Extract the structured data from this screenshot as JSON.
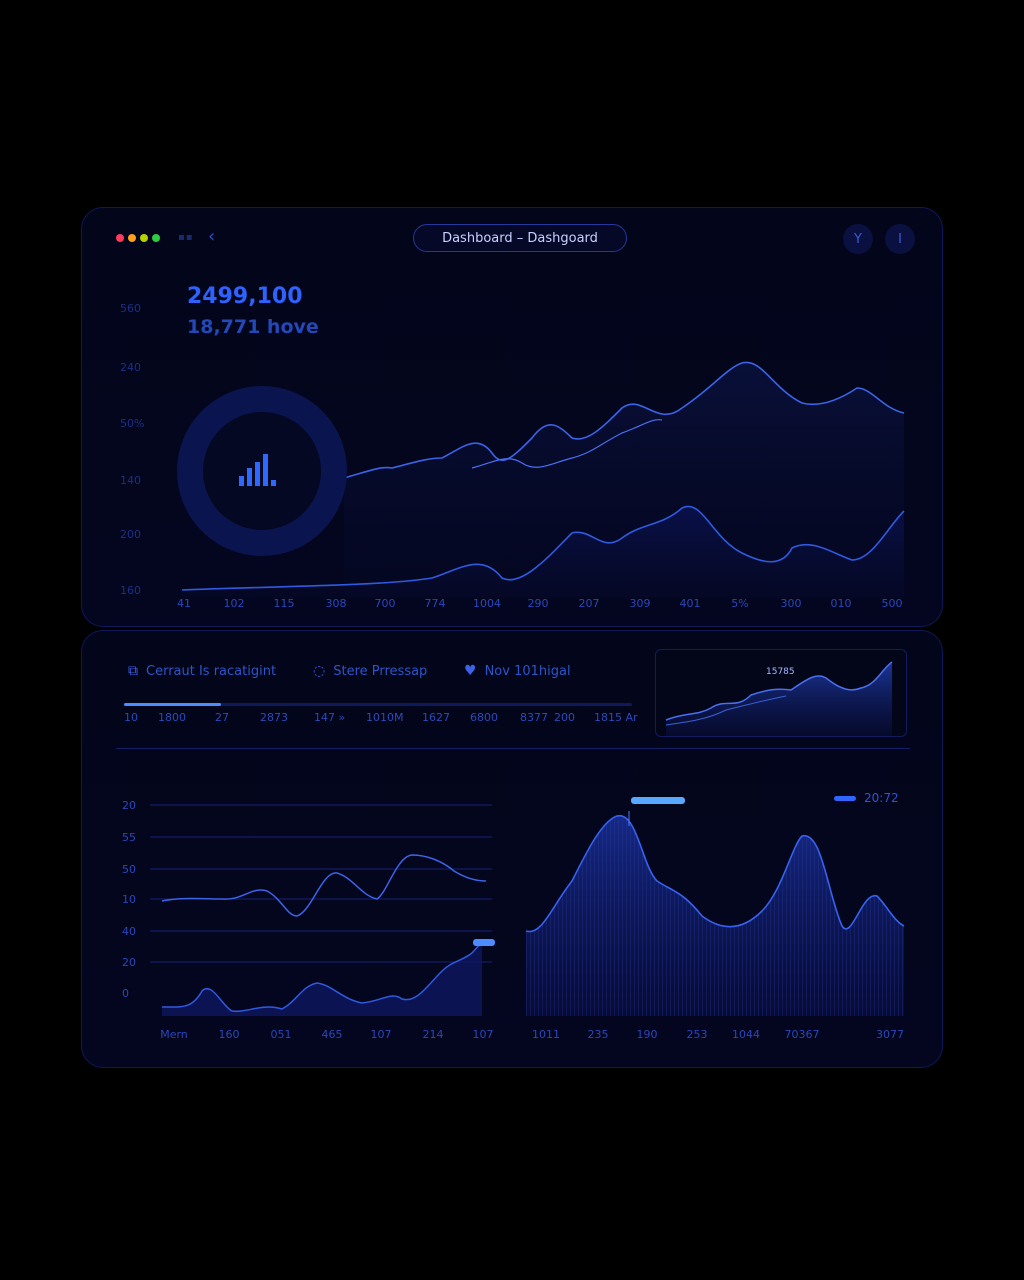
{
  "window": {
    "title": "Dashboard – Dashgoard",
    "controls": [
      "Y",
      "I"
    ],
    "traffic_colors": [
      "#ff3b5c",
      "#ff9f1a",
      "#b6d300",
      "#2ecc40"
    ]
  },
  "kpi": {
    "main": "2499,100",
    "sub": "18,771 hove"
  },
  "legend": {
    "items": [
      {
        "label": "Cerraut Is racatigint",
        "icon": "layers-icon"
      },
      {
        "label": "Stere Prressap",
        "icon": "loading-icon"
      },
      {
        "label": "Nov 101higal",
        "icon": "heart-icon"
      }
    ],
    "progress": 0.19
  },
  "stats": [
    "10",
    "1800",
    "27",
    "2873",
    "147 »",
    "1010M",
    "1627",
    "6800",
    "8377",
    "200",
    "1815 Ar"
  ],
  "mini_chart": {
    "label": "15785"
  },
  "bottom_right": {
    "legend": "20:72"
  },
  "chart_data": [
    {
      "type": "area",
      "y_ticks": [
        "560",
        "240",
        "50%",
        "140",
        "200",
        "160"
      ],
      "x_ticks": [
        "41",
        "102",
        "115",
        "308",
        "700",
        "774",
        "1004",
        "290",
        "207",
        "309",
        "401",
        "5%",
        "300",
        "010",
        "500"
      ],
      "series": [
        {
          "values": [
            52,
            48,
            49,
            50,
            56,
            60,
            61,
            62,
            70,
            74,
            71,
            68,
            58,
            64,
            72,
            84,
            76,
            74,
            79,
            74,
            78,
            72,
            70
          ]
        },
        {
          "values": [
            160,
            161,
            162,
            163,
            167,
            175,
            172,
            180,
            186,
            182,
            190,
            195,
            186,
            178,
            180,
            176,
            182,
            186,
            193
          ]
        },
        {
          "values": [
            15,
            18,
            24,
            28,
            36,
            44,
            52,
            58,
            56,
            64,
            70,
            68
          ]
        }
      ]
    },
    {
      "type": "area",
      "y_ticks": [
        "20",
        "55",
        "50",
        "10",
        "40",
        "20",
        "0"
      ],
      "x_ticks": [
        "Mern",
        "160",
        "051",
        "465",
        "107",
        "214",
        "107"
      ],
      "series": [
        {
          "values": [
            10,
            12,
            11,
            10,
            13,
            10,
            8,
            14,
            17,
            12,
            18,
            21,
            20,
            17
          ]
        },
        {
          "values": [
            2,
            2,
            6,
            2,
            3,
            2,
            4,
            6,
            5,
            3,
            4,
            6,
            9,
            22,
            28
          ]
        }
      ]
    },
    {
      "type": "area",
      "x_ticks": [
        "1011",
        "235",
        "190",
        "253",
        "1044",
        "70367",
        "3077"
      ],
      "series": [
        {
          "name": "20:72",
          "values": [
            28,
            32,
            52,
            86,
            76,
            58,
            46,
            40,
            44,
            50,
            70,
            62,
            40,
            52,
            44
          ]
        }
      ]
    }
  ]
}
